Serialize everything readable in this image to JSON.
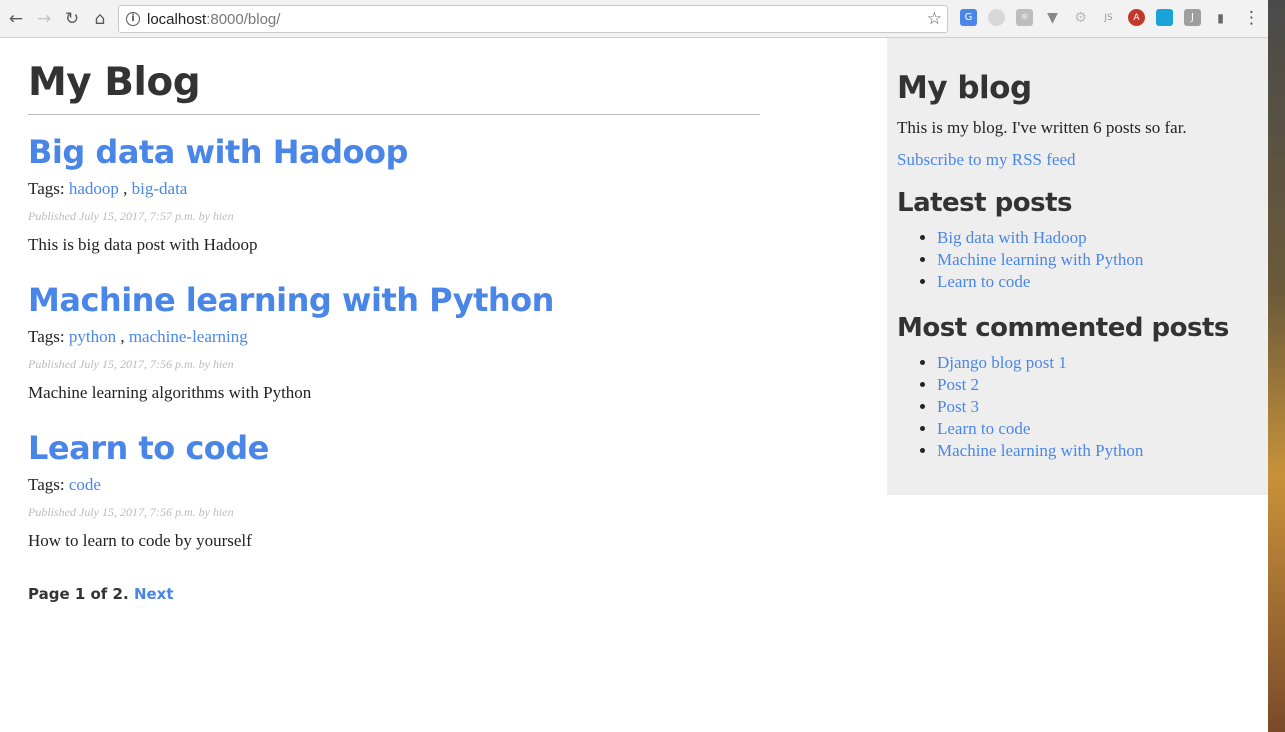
{
  "browser": {
    "url_host": "localhost",
    "url_rest": ":8000/blog/"
  },
  "blog": {
    "title": "My Blog",
    "posts": [
      {
        "title": "Big data with Hadoop",
        "tags_label": "Tags:",
        "tags": [
          "hadoop",
          "big-data"
        ],
        "published": "Published July 15, 2017, 7:57 p.m. by hien",
        "excerpt": "This is big data post with Hadoop"
      },
      {
        "title": "Machine learning with Python",
        "tags_label": "Tags:",
        "tags": [
          "python",
          "machine-learning"
        ],
        "published": "Published July 15, 2017, 7:56 p.m. by hien",
        "excerpt": "Machine learning algorithms with Python"
      },
      {
        "title": "Learn to code",
        "tags_label": "Tags:",
        "tags": [
          "code"
        ],
        "published": "Published July 15, 2017, 7:56 p.m. by hien",
        "excerpt": "How to learn to code by yourself"
      }
    ],
    "pagination": {
      "text": "Page 1 of 2.",
      "next": "Next"
    }
  },
  "sidebar": {
    "title": "My blog",
    "description": "This is my blog. I've written 6 posts so far.",
    "rss_link": "Subscribe to my RSS feed",
    "latest_heading": "Latest posts",
    "latest": [
      "Big data with Hadoop",
      "Machine learning with Python",
      "Learn to code"
    ],
    "most_commented_heading": "Most commented posts",
    "most_commented": [
      "Django blog post 1",
      "Post 2",
      "Post 3",
      "Learn to code",
      "Machine learning with Python"
    ]
  },
  "colors": {
    "link": "#4a86e8",
    "sidebar_bg": "#eeeeee"
  }
}
